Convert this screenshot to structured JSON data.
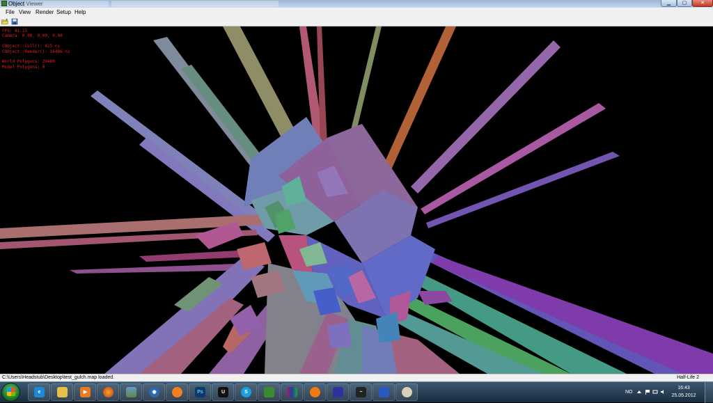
{
  "window": {
    "title": "Object Viewer"
  },
  "colors": {
    "overlay_text": "#e02020",
    "status_bar": "#f0f0f0",
    "taskbar": "#1f3346"
  },
  "menu": [
    "File",
    "View",
    "Render",
    "Setup",
    "Help"
  ],
  "toolbar": {
    "open_icon": "folder-open-icon",
    "save_icon": "save-disk-icon"
  },
  "overlay": {
    "fps": "FPS: 41.15",
    "camera": "Camera: 0.00, 0.00, 0.00",
    "cull": "CObject::Cull(): 425 ns",
    "render": "CObject::Render(): 16486 ns",
    "world_polygons": "World Polygons: 29480",
    "model_polygons": "Model Polygons: 0"
  },
  "status": {
    "message": "C:\\Users\\Headstub\\Desktop\\test_gulch.map loaded.",
    "right": "Half-Life 2"
  },
  "taskbar": {
    "apps": [
      "Internet Explorer",
      "Windows Explorer",
      "Media Player",
      "Firefox",
      "Image Viewer",
      "Viewer",
      "Browser",
      "Photoshop",
      "UDK",
      "Skype",
      "Steam",
      "WinRAR",
      "Blender",
      "Notepad",
      "Steam",
      "Tool",
      "Paint"
    ],
    "tray_language": "NO",
    "time": "16:43",
    "date": "25.05.2012"
  }
}
